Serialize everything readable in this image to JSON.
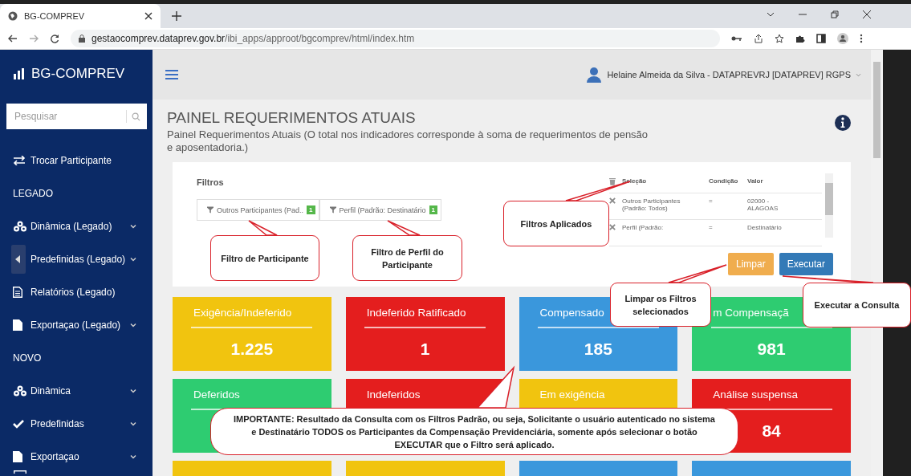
{
  "browser": {
    "tab_title": "BG-COMPREV",
    "url_host": "gestaocomprev.dataprev.gov.br",
    "url_path": "/ibi_apps/approot/bgcomprev/html/index.htm"
  },
  "app": {
    "logo": "BG-COMPREV",
    "user": "Helaine Almeida da Silva - DATAPREVRJ [DATAPREV] RGPS"
  },
  "sidebar": {
    "search_placeholder": "Pesquisar",
    "items": [
      {
        "kind": "link",
        "label": "Trocar Participante",
        "expandable": false
      },
      {
        "kind": "section",
        "label": "LEGADO"
      },
      {
        "kind": "link",
        "label": "Dinâmica (Legado)",
        "expandable": true
      },
      {
        "kind": "link",
        "label": "Predefinidas (Legado)",
        "expandable": true
      },
      {
        "kind": "link",
        "label": "Relatórios (Legado)",
        "expandable": false
      },
      {
        "kind": "link",
        "label": "Exportaçao (Legado)",
        "expandable": true
      },
      {
        "kind": "section",
        "label": "NOVO"
      },
      {
        "kind": "link",
        "label": "Dinâmica",
        "expandable": true
      },
      {
        "kind": "link",
        "label": "Predefinidas",
        "expandable": true
      },
      {
        "kind": "link",
        "label": "Exportaçao",
        "expandable": true
      }
    ]
  },
  "page": {
    "title": "PAINEL REQUERIMENTOS ATUAIS",
    "subtitle": "Painel Requerimentos Atuais (O total nos indicadores corresponde à soma de requerimentos de pensão e aposentadoria.)"
  },
  "filters": {
    "title": "Filtros",
    "chips": [
      {
        "label": "Outros Participantes (Pad..",
        "count": "1"
      },
      {
        "label": "Perfil (Padrão: Destinatário",
        "count": "1"
      }
    ],
    "applied": {
      "columns": [
        "Seleção",
        "Condição",
        "Valor"
      ],
      "rows": [
        [
          "Outros Participantes (Padrão: Todos)",
          "=",
          "02000 - ALAGOAS"
        ],
        [
          "Perfil (Padrão:",
          "=",
          "Destinatário"
        ]
      ]
    },
    "buttons": [
      {
        "label": "Limpar",
        "kind": "warning"
      },
      {
        "label": "Executar",
        "kind": "primary"
      }
    ]
  },
  "cards": [
    {
      "label": "Exigência/Indeferido",
      "value": "1.225",
      "color": "#f1c40f"
    },
    {
      "label": "Indeferido Ratificado",
      "value": "1",
      "color": "#e41e1e"
    },
    {
      "label": "Compensado",
      "value": "185",
      "color": "#3a97dc"
    },
    {
      "label": "m Compensaçã",
      "value": "981",
      "color": "#2ecc71"
    },
    {
      "label": "Deferidos",
      "color": "#2ecc71"
    },
    {
      "label": "Indeferidos",
      "color": "#e41e1e"
    },
    {
      "label": "Em exigência",
      "color": "#f1c40f"
    },
    {
      "label": "Análise suspensa",
      "value": "84",
      "color": "#e41e1e"
    },
    {
      "color": "#f1c40f"
    },
    {
      "color": "#f1c40f"
    },
    {
      "color": "#3a97dc"
    },
    {
      "color": "#3a97dc"
    }
  ],
  "callouts": [
    {
      "text": "Filtro de Participante"
    },
    {
      "text": "Filtro de Perfil do Participante"
    },
    {
      "text": "Filtros Aplicados"
    },
    {
      "text": "Limpar os Filtros selecionados"
    },
    {
      "text": "Executar a Consulta"
    },
    {
      "text": "IMPORTANTE: Resultado da Consulta com os Filtros Padrão, ou seja, Solicitante o usuário autenticado no sistema e Destinatário TODOS os Participantes da Compensação Previdenciária, somente após selecionar o botão EXECUTAR que o Filtro será aplicado."
    }
  ]
}
